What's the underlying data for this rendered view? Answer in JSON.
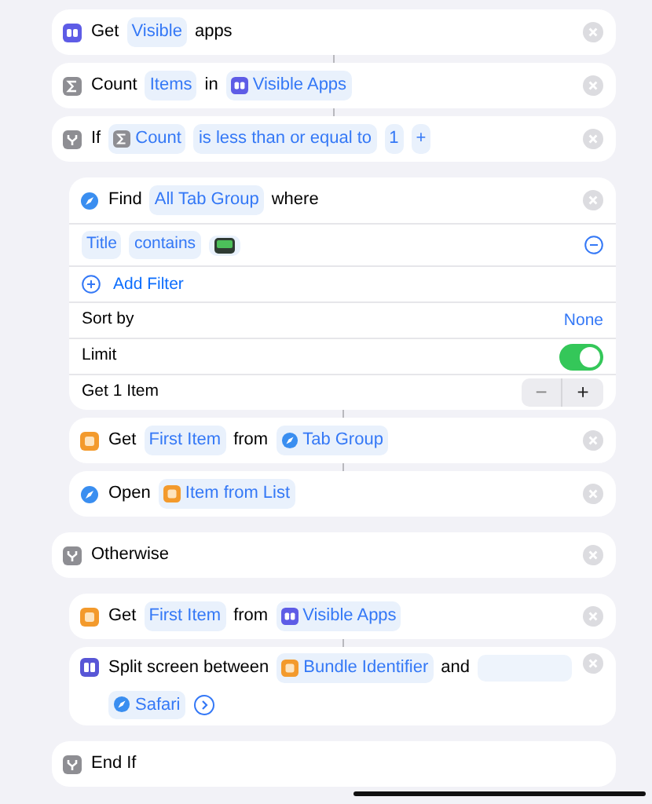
{
  "actions": [
    {
      "kind": "get-apps",
      "parts": [
        {
          "kind": "text",
          "text": "Get"
        },
        {
          "kind": "param",
          "text": "Visible"
        },
        {
          "kind": "text",
          "text": "apps"
        }
      ]
    },
    {
      "kind": "count",
      "parts": [
        {
          "kind": "text",
          "text": "Count"
        },
        {
          "kind": "param",
          "text": "Items"
        },
        {
          "kind": "text",
          "text": "in"
        },
        {
          "kind": "apps-variable",
          "text": "Visible Apps"
        }
      ]
    },
    {
      "kind": "if",
      "parts": [
        {
          "kind": "text",
          "text": "If"
        },
        {
          "kind": "count-variable",
          "text": "Count"
        },
        {
          "kind": "param",
          "text": "is less than or equal to"
        },
        {
          "kind": "param",
          "text": "1"
        },
        {
          "kind": "add",
          "text": "+"
        }
      ],
      "children": [
        {
          "kind": "find",
          "parts": [
            {
              "kind": "text",
              "text": "Find"
            },
            {
              "kind": "param",
              "text": "All Tab Group"
            },
            {
              "kind": "text",
              "text": "where"
            }
          ],
          "filters": [
            {
              "parts": [
                {
                  "kind": "param",
                  "text": "Title"
                },
                {
                  "kind": "param",
                  "text": "contains"
                },
                {
                  "kind": "image"
                }
              ]
            }
          ],
          "add_filter": "Add Filter",
          "options": [
            {
              "kind": "value",
              "label": "Sort by",
              "value": "None"
            },
            {
              "kind": "toggle",
              "label": "Limit",
              "on": true
            },
            {
              "kind": "stepper",
              "label": "Get 1 Item",
              "minus": "−",
              "plus": "+"
            }
          ]
        },
        {
          "kind": "get-item",
          "parts": [
            {
              "kind": "text",
              "text": "Get"
            },
            {
              "kind": "param",
              "text": "First Item"
            },
            {
              "kind": "text",
              "text": "from"
            },
            {
              "kind": "safari-variable",
              "text": "Tab Group"
            }
          ]
        },
        {
          "kind": "open",
          "parts": [
            {
              "kind": "text",
              "text": "Open"
            },
            {
              "kind": "list-variable",
              "text": "Item from List"
            }
          ]
        }
      ]
    },
    {
      "kind": "otherwise",
      "parts": [
        {
          "kind": "text",
          "text": "Otherwise"
        }
      ],
      "children": [
        {
          "kind": "get-item",
          "parts": [
            {
              "kind": "text",
              "text": "Get"
            },
            {
              "kind": "param",
              "text": "First Item"
            },
            {
              "kind": "text",
              "text": "from"
            },
            {
              "kind": "apps-variable",
              "text": "Visible Apps"
            }
          ]
        },
        {
          "kind": "split",
          "parts": [
            {
              "kind": "text",
              "text": "Split screen between"
            },
            {
              "kind": "list-variable",
              "text": "Bundle Identifier"
            },
            {
              "kind": "text",
              "text": "and"
            },
            {
              "kind": "blank"
            },
            {
              "kind": "safari-variable",
              "text": "Safari"
            },
            {
              "kind": "expand"
            }
          ]
        }
      ]
    },
    {
      "kind": "end",
      "parts": [
        {
          "kind": "text",
          "text": "End If"
        }
      ]
    }
  ]
}
